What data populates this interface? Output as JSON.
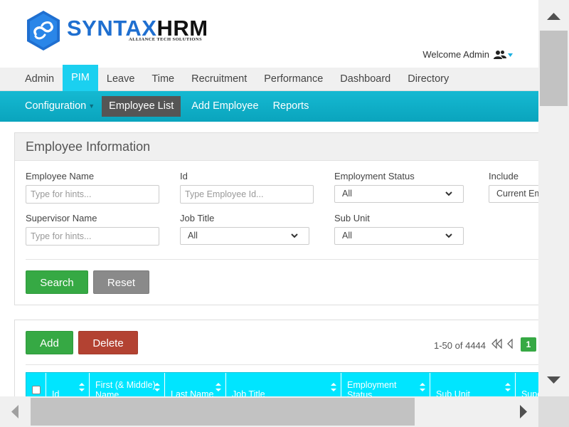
{
  "header": {
    "logo_main": "SYNTAX",
    "logo_accent": "HRM",
    "logo_sub": "ALLIANCE TECH SOLUTIONS",
    "welcome": "Welcome Admin",
    "user_icon": "users-icon"
  },
  "mainnav": {
    "items": [
      {
        "label": "Admin"
      },
      {
        "label": "PIM",
        "active": true
      },
      {
        "label": "Leave"
      },
      {
        "label": "Time"
      },
      {
        "label": "Recruitment"
      },
      {
        "label": "Performance"
      },
      {
        "label": "Dashboard"
      },
      {
        "label": "Directory"
      }
    ]
  },
  "subnav": {
    "items": [
      {
        "label": "Configuration"
      },
      {
        "label": "Employee List",
        "active": true
      },
      {
        "label": "Add Employee"
      },
      {
        "label": "Reports"
      }
    ]
  },
  "search_panel": {
    "title": "Employee Information",
    "employee_name": {
      "label": "Employee Name",
      "placeholder": "Type for hints...",
      "value": ""
    },
    "id": {
      "label": "Id",
      "placeholder": "Type Employee Id...",
      "value": ""
    },
    "employment_status": {
      "label": "Employment Status",
      "value": "All"
    },
    "include": {
      "label": "Include",
      "value": "Current Employees Only"
    },
    "supervisor_name": {
      "label": "Supervisor Name",
      "placeholder": "Type for hints...",
      "value": ""
    },
    "job_title": {
      "label": "Job Title",
      "value": "All"
    },
    "sub_unit": {
      "label": "Sub Unit",
      "value": "All"
    },
    "search_label": "Search",
    "reset_label": "Reset"
  },
  "list_panel": {
    "add_label": "Add",
    "delete_label": "Delete",
    "paging_text": "1-50 of 4444",
    "current_page": "1",
    "columns": [
      {
        "label": "Id"
      },
      {
        "label": "First (& Middle) Name"
      },
      {
        "label": "Last Name"
      },
      {
        "label": "Job Title"
      },
      {
        "label": "Employment Status"
      },
      {
        "label": "Sub Unit"
      },
      {
        "label": "Supervisor"
      }
    ]
  },
  "colors": {
    "brand_blue": "#1f6fd0",
    "nav_active": "#1bd0f0",
    "subnav": "#0aa4bd",
    "table_header": "#00e5ff",
    "button_green": "#36a944",
    "button_gray": "#8a8a8a",
    "button_red": "#b34232"
  }
}
